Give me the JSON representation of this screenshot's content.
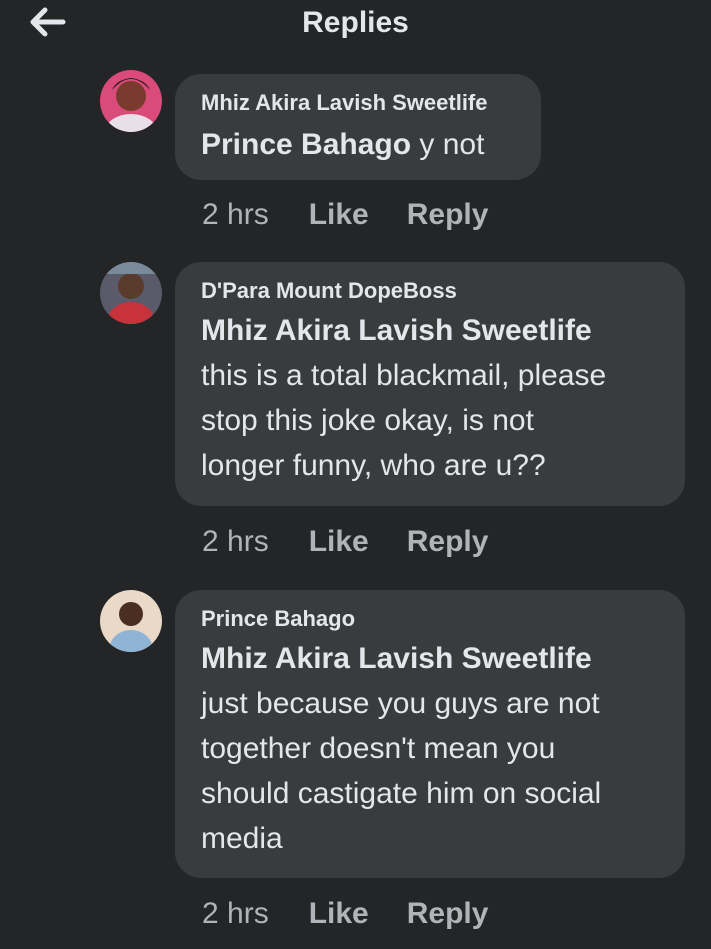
{
  "header": {
    "title": "Replies",
    "back_icon": "arrow-left-icon"
  },
  "colors": {
    "background": "#242526",
    "bubble": "#3a3b3c",
    "primary_text": "#e4e6eb",
    "secondary_text": "#b0b3b8"
  },
  "comments": [
    {
      "author": "Mhiz Akira Lavish Sweetlife",
      "mention": "Prince Bahago",
      "lines": [
        "y not"
      ],
      "time": "2 hrs",
      "like_label": "Like",
      "reply_label": "Reply"
    },
    {
      "author": "D'Para Mount DopeBoss",
      "mention": "Mhiz Akira Lavish Sweetlife",
      "lines": [
        "this is a total blackmail, please",
        "stop this joke okay, is not",
        "longer funny, who are u??"
      ],
      "time": "2 hrs",
      "like_label": "Like",
      "reply_label": "Reply"
    },
    {
      "author": "Prince Bahago",
      "mention": "Mhiz Akira Lavish Sweetlife",
      "lines": [
        "just because you guys are not",
        "together doesn't mean you",
        "should castigate him on social",
        "media"
      ],
      "time": "2 hrs",
      "like_label": "Like",
      "reply_label": "Reply"
    }
  ]
}
